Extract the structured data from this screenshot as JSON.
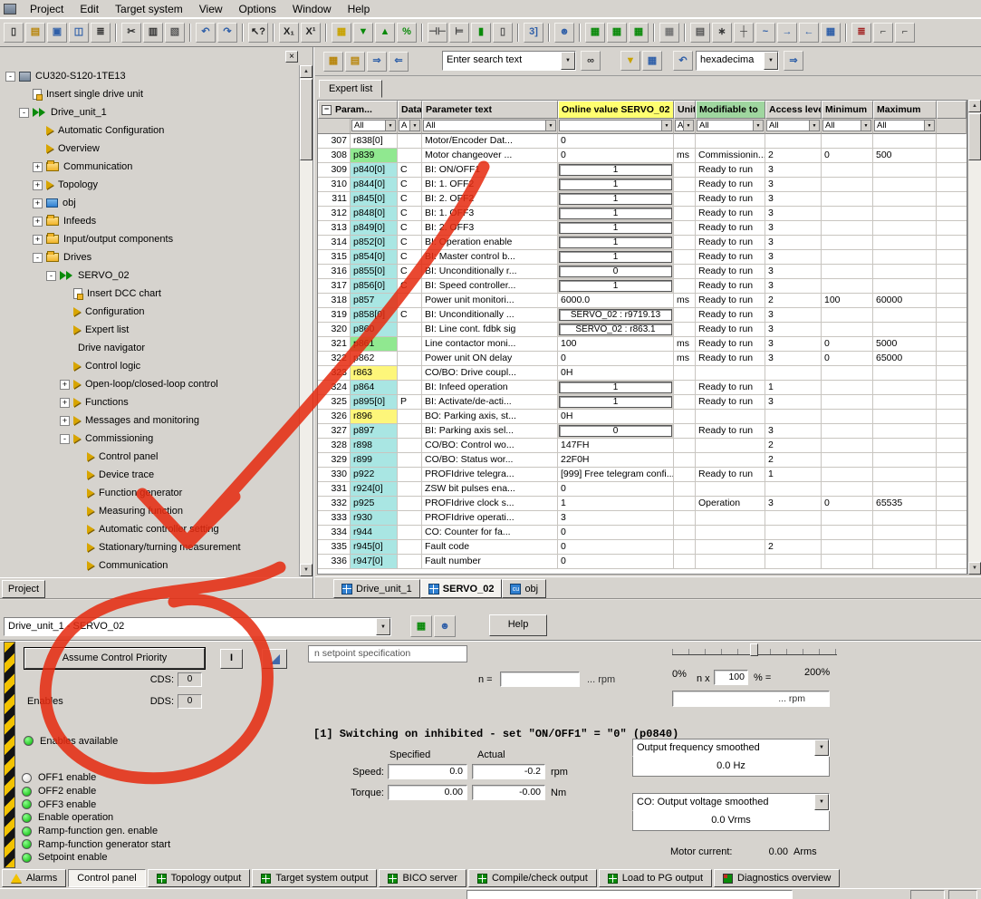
{
  "colors": {
    "annotation_red": "#e62b10",
    "online_header_bg": "#ffff70",
    "modifiable_header_bg": "#9fd69f",
    "param_cyan": "#a9e6e3",
    "param_green": "#90e890",
    "param_yellow": "#fdf67a",
    "param_white": "#ffffff",
    "led_on": "#00b400",
    "led_off": "#d8d5d0"
  },
  "menu": {
    "items": [
      "Project",
      "Edit",
      "Target system",
      "View",
      "Options",
      "Window",
      "Help"
    ]
  },
  "toolbar_main": {
    "buttons": [
      {
        "n": "new-document-icon",
        "g": "▯",
        "c": "#333333"
      },
      {
        "n": "open-folder-icon",
        "g": "▤",
        "c": "#b8860b"
      },
      {
        "n": "save-icon",
        "g": "▣",
        "c": "#2f5fa8"
      },
      {
        "n": "save-compile-icon",
        "g": "◫",
        "c": "#2f5fa8"
      },
      {
        "n": "print-icon",
        "g": "≣",
        "c": "#333333"
      },
      {
        "sep": true
      },
      {
        "n": "cut-icon",
        "g": "✂",
        "c": "#333333"
      },
      {
        "n": "copy-icon",
        "g": "▥",
        "c": "#333333"
      },
      {
        "n": "paste-icon",
        "g": "▧",
        "c": "#555555"
      },
      {
        "sep": true
      },
      {
        "n": "undo-icon",
        "g": "↶",
        "c": "#2f5fa8"
      },
      {
        "n": "redo-icon",
        "g": "↷",
        "c": "#2f5fa8"
      },
      {
        "sep": true
      },
      {
        "n": "help-pointer-icon",
        "g": "↖?",
        "c": "#222222"
      },
      {
        "sep": true
      },
      {
        "n": "x-sub-icon",
        "g": "X₁",
        "c": "#222222"
      },
      {
        "n": "x-sup-icon",
        "g": "X¹",
        "c": "#222222"
      },
      {
        "sep": true
      },
      {
        "n": "accessible-params-icon",
        "g": "▦",
        "c": "#c8a200"
      },
      {
        "n": "download-target-icon",
        "g": "▼",
        "c": "#0a8a0a"
      },
      {
        "n": "upload-pg-icon",
        "g": "▲",
        "c": "#0a8a0a"
      },
      {
        "n": "compare-params-icon",
        "g": "%",
        "c": "#0a8a0a"
      },
      {
        "sep": true
      },
      {
        "n": "disconnect-icon",
        "g": "⊣⊢",
        "c": "#444444"
      },
      {
        "n": "connect-icon",
        "g": "⊨",
        "c": "#444444"
      },
      {
        "n": "online-icon",
        "g": "▮",
        "c": "#0a8a0a"
      },
      {
        "n": "offline-icon",
        "g": "▯",
        "c": "#555555"
      },
      {
        "sep": true
      },
      {
        "n": "datasets-icon",
        "g": "3]",
        "c": "#2f5fa8"
      },
      {
        "sep": true
      },
      {
        "n": "users-icon",
        "g": "☻",
        "c": "#2f5fa8"
      },
      {
        "sep": true
      },
      {
        "n": "chart-1-icon",
        "g": "▦",
        "c": "#0a8a0a"
      },
      {
        "n": "chart-2-icon",
        "g": "▦",
        "c": "#0a8a0a"
      },
      {
        "n": "chart-3-icon",
        "g": "▦",
        "c": "#0a8a0a"
      },
      {
        "sep": true
      },
      {
        "n": "watch-table-icon",
        "g": "▦",
        "c": "#777777"
      },
      {
        "sep": true
      },
      {
        "n": "book-icon",
        "g": "▤",
        "c": "#555555"
      },
      {
        "n": "gear-icon",
        "g": "∗",
        "c": "#333333"
      },
      {
        "n": "insert-row-icon",
        "g": "┼",
        "c": "#444444"
      },
      {
        "n": "curve-icon",
        "g": "~",
        "c": "#2f5fa8"
      },
      {
        "n": "move-right-icon",
        "g": "→",
        "c": "#2f5fa8"
      },
      {
        "n": "move-left-icon",
        "g": "←",
        "c": "#2f5fa8"
      },
      {
        "n": "grid-select-icon",
        "g": "▦",
        "c": "#2f5fa8"
      },
      {
        "sep": true
      },
      {
        "n": "output-list-icon",
        "g": "≣",
        "c": "#a22222"
      },
      {
        "n": "dock-left-icon",
        "g": "⌐",
        "c": "#444444"
      },
      {
        "n": "dock-right-icon",
        "g": "⌐",
        "c": "#444444"
      }
    ]
  },
  "toolbar_list": {
    "icons_left": [
      {
        "n": "list-edit-icon",
        "g": "▦",
        "c": "#b8860b"
      },
      {
        "n": "list-open-icon",
        "g": "▤",
        "c": "#b8860b"
      },
      {
        "n": "list-import-icon",
        "g": "⇒",
        "c": "#2f5fa8"
      },
      {
        "n": "list-export-icon",
        "g": "⇐",
        "c": "#2f5fa8"
      }
    ],
    "search_value": "Enter search text",
    "format_value": "hexadecima"
  },
  "tree": {
    "items": [
      {
        "label": "CU320-S120-1TE13",
        "level": 0,
        "exp": "-",
        "icon": "cu"
      },
      {
        "label": "Insert single drive unit",
        "level": 1,
        "icon": "insert"
      },
      {
        "label": "Drive_unit_1",
        "level": 1,
        "exp": "-",
        "icon": "unit"
      },
      {
        "label": "Automatic Configuration",
        "level": 2,
        "icon": "arrow"
      },
      {
        "label": "Overview",
        "level": 2,
        "icon": "arrow"
      },
      {
        "label": "Communication",
        "level": 2,
        "exp": "+",
        "icon": "folder"
      },
      {
        "label": "Topology",
        "level": 2,
        "exp": "+",
        "icon": "arrow"
      },
      {
        "label": "obj",
        "level": 2,
        "exp": "+",
        "icon": "obj"
      },
      {
        "label": "Infeeds",
        "level": 2,
        "exp": "+",
        "icon": "folder"
      },
      {
        "label": "Input/output components",
        "level": 2,
        "exp": "+",
        "icon": "folder"
      },
      {
        "label": "Drives",
        "level": 2,
        "exp": "-",
        "icon": "folder"
      },
      {
        "label": "SERVO_02",
        "level": 3,
        "exp": "-",
        "icon": "drive"
      },
      {
        "label": "Insert DCC chart",
        "level": 4,
        "icon": "insert"
      },
      {
        "label": "Configuration",
        "level": 4,
        "icon": "arrow"
      },
      {
        "label": "Expert list",
        "level": 4,
        "icon": "arrow"
      },
      {
        "label": "Drive navigator",
        "level": 4,
        "icon": "navigator"
      },
      {
        "label": "Control logic",
        "level": 4,
        "icon": "arrow"
      },
      {
        "label": "Open-loop/closed-loop control",
        "level": 4,
        "exp": "+",
        "icon": "arrow"
      },
      {
        "label": "Functions",
        "level": 4,
        "exp": "+",
        "icon": "arrow"
      },
      {
        "label": "Messages and monitoring",
        "level": 4,
        "exp": "+",
        "icon": "arrow"
      },
      {
        "label": "Commissioning",
        "level": 4,
        "exp": "-",
        "icon": "arrow"
      },
      {
        "label": "Control panel",
        "level": 5,
        "icon": "arrow"
      },
      {
        "label": "Device trace",
        "level": 5,
        "icon": "arrow"
      },
      {
        "label": "Function generator",
        "level": 5,
        "icon": "arrow"
      },
      {
        "label": "Measuring function",
        "level": 5,
        "icon": "arrow"
      },
      {
        "label": "Automatic controller setting",
        "level": 5,
        "icon": "arrow"
      },
      {
        "label": "Stationary/turning measurement",
        "level": 5,
        "icon": "arrow"
      },
      {
        "label": "Communication",
        "level": 5,
        "icon": "arrow"
      }
    ]
  },
  "tabs": {
    "project_tab": "Project",
    "expert_tab": "Expert list",
    "doc_tabs": [
      {
        "label": "Drive_unit_1",
        "icon": "grid"
      },
      {
        "label": "SERVO_02",
        "icon": "grid",
        "active": true
      },
      {
        "label": "obj",
        "icon": "cu",
        "icon_text": "cu"
      }
    ]
  },
  "table": {
    "headers": [
      "Param...",
      "Data",
      "Parameter text",
      "Online value SERVO_02",
      "Unit",
      "Modifiable to",
      "Access level",
      "Minimum",
      "Maximum"
    ],
    "filters": [
      "All",
      "A",
      "All",
      "",
      "Al",
      "All",
      "All",
      "All",
      "All"
    ],
    "rows": [
      {
        "n": "307",
        "p": "r838[0]",
        "pc": "w",
        "d": "",
        "t": "Motor/Encoder Dat...",
        "v": "0",
        "b": 0,
        "u": "",
        "m": "",
        "a": "",
        "mi": "",
        "ma": ""
      },
      {
        "n": "308",
        "p": "p839",
        "pc": "g",
        "d": "",
        "t": "Motor changeover ...",
        "v": "0",
        "b": 0,
        "u": "ms",
        "m": "Commissionin...",
        "a": "2",
        "mi": "0",
        "ma": "500"
      },
      {
        "n": "309",
        "p": "p840[0]",
        "pc": "c",
        "d": "C",
        "t": "BI: ON/OFF1",
        "v": "1",
        "b": 1,
        "u": "",
        "m": "Ready to run",
        "a": "3",
        "mi": "",
        "ma": ""
      },
      {
        "n": "310",
        "p": "p844[0]",
        "pc": "c",
        "d": "C",
        "t": "BI: 1. OFF2",
        "v": "1",
        "b": 1,
        "u": "",
        "m": "Ready to run",
        "a": "3",
        "mi": "",
        "ma": ""
      },
      {
        "n": "311",
        "p": "p845[0]",
        "pc": "c",
        "d": "C",
        "t": "BI: 2. OFF2",
        "v": "1",
        "b": 1,
        "u": "",
        "m": "Ready to run",
        "a": "3",
        "mi": "",
        "ma": ""
      },
      {
        "n": "312",
        "p": "p848[0]",
        "pc": "c",
        "d": "C",
        "t": "BI: 1. OFF3",
        "v": "1",
        "b": 1,
        "u": "",
        "m": "Ready to run",
        "a": "3",
        "mi": "",
        "ma": ""
      },
      {
        "n": "313",
        "p": "p849[0]",
        "pc": "c",
        "d": "C",
        "t": "BI: 2. OFF3",
        "v": "1",
        "b": 1,
        "u": "",
        "m": "Ready to run",
        "a": "3",
        "mi": "",
        "ma": ""
      },
      {
        "n": "314",
        "p": "p852[0]",
        "pc": "c",
        "d": "C",
        "t": "BI: Operation enable",
        "v": "1",
        "b": 1,
        "u": "",
        "m": "Ready to run",
        "a": "3",
        "mi": "",
        "ma": ""
      },
      {
        "n": "315",
        "p": "p854[0]",
        "pc": "c",
        "d": "C",
        "t": "BI: Master control b...",
        "v": "1",
        "b": 1,
        "u": "",
        "m": "Ready to run",
        "a": "3",
        "mi": "",
        "ma": ""
      },
      {
        "n": "316",
        "p": "p855[0]",
        "pc": "c",
        "d": "C",
        "t": "BI: Unconditionally r...",
        "v": "0",
        "b": 1,
        "u": "",
        "m": "Ready to run",
        "a": "3",
        "mi": "",
        "ma": ""
      },
      {
        "n": "317",
        "p": "p856[0]",
        "pc": "c",
        "d": "C",
        "t": "BI: Speed controller...",
        "v": "1",
        "b": 1,
        "u": "",
        "m": "Ready to run",
        "a": "3",
        "mi": "",
        "ma": ""
      },
      {
        "n": "318",
        "p": "p857",
        "pc": "c",
        "d": "",
        "t": "Power unit monitori...",
        "v": "6000.0",
        "b": 0,
        "u": "ms",
        "m": "Ready to run",
        "a": "2",
        "mi": "100",
        "ma": "60000"
      },
      {
        "n": "319",
        "p": "p858[0]",
        "pc": "c",
        "d": "C",
        "t": "BI: Unconditionally ...",
        "v": "SERVO_02 : r9719.13",
        "b": 1,
        "u": "",
        "m": "Ready to run",
        "a": "3",
        "mi": "",
        "ma": ""
      },
      {
        "n": "320",
        "p": "p860",
        "pc": "c",
        "d": "",
        "t": "BI: Line cont. fdbk sig",
        "v": "SERVO_02 : r863.1",
        "b": 1,
        "u": "",
        "m": "Ready to run",
        "a": "3",
        "mi": "",
        "ma": ""
      },
      {
        "n": "321",
        "p": "p861",
        "pc": "g",
        "d": "",
        "t": "Line contactor moni...",
        "v": "100",
        "b": 0,
        "u": "ms",
        "m": "Ready to run",
        "a": "3",
        "mi": "0",
        "ma": "5000"
      },
      {
        "n": "322",
        "p": "p862",
        "pc": "w",
        "d": "",
        "t": "Power unit ON delay",
        "v": "0",
        "b": 0,
        "u": "ms",
        "m": "Ready to run",
        "a": "3",
        "mi": "0",
        "ma": "65000"
      },
      {
        "n": "323",
        "p": "r863",
        "pc": "y",
        "d": "",
        "t": "CO/BO: Drive coupl...",
        "v": "0H",
        "b": 0,
        "u": "",
        "m": "",
        "a": "",
        "mi": "",
        "ma": ""
      },
      {
        "n": "324",
        "p": "p864",
        "pc": "c",
        "d": "",
        "t": "BI: Infeed operation",
        "v": "1",
        "b": 1,
        "u": "",
        "m": "Ready to run",
        "a": "1",
        "mi": "",
        "ma": ""
      },
      {
        "n": "325",
        "p": "p895[0]",
        "pc": "c",
        "d": "P",
        "t": "BI: Activate/de-acti...",
        "v": "1",
        "b": 1,
        "u": "",
        "m": "Ready to run",
        "a": "3",
        "mi": "",
        "ma": ""
      },
      {
        "n": "326",
        "p": "r896",
        "pc": "y",
        "d": "",
        "t": "BO: Parking axis, st...",
        "v": "0H",
        "b": 0,
        "u": "",
        "m": "",
        "a": "",
        "mi": "",
        "ma": ""
      },
      {
        "n": "327",
        "p": "p897",
        "pc": "c",
        "d": "",
        "t": "BI: Parking axis sel...",
        "v": "0",
        "b": 1,
        "u": "",
        "m": "Ready to run",
        "a": "3",
        "mi": "",
        "ma": ""
      },
      {
        "n": "328",
        "p": "r898",
        "pc": "c",
        "d": "",
        "t": "CO/BO: Control wo...",
        "v": "147FH",
        "b": 0,
        "u": "",
        "m": "",
        "a": "2",
        "mi": "",
        "ma": ""
      },
      {
        "n": "329",
        "p": "r899",
        "pc": "c",
        "d": "",
        "t": "CO/BO: Status wor...",
        "v": "22F0H",
        "b": 0,
        "u": "",
        "m": "",
        "a": "2",
        "mi": "",
        "ma": ""
      },
      {
        "n": "330",
        "p": "p922",
        "pc": "c",
        "d": "",
        "t": "PROFIdrive telegra...",
        "v": "[999] Free telegram confi...",
        "b": 0,
        "u": "",
        "m": "Ready to run",
        "a": "1",
        "mi": "",
        "ma": ""
      },
      {
        "n": "331",
        "p": "r924[0]",
        "pc": "c",
        "d": "",
        "t": "ZSW bit pulses ena...",
        "v": "0",
        "b": 0,
        "u": "",
        "m": "",
        "a": "",
        "mi": "",
        "ma": ""
      },
      {
        "n": "332",
        "p": "p925",
        "pc": "c",
        "d": "",
        "t": "PROFIdrive clock s...",
        "v": "1",
        "b": 0,
        "u": "",
        "m": "Operation",
        "a": "3",
        "mi": "0",
        "ma": "65535"
      },
      {
        "n": "333",
        "p": "r930",
        "pc": "c",
        "d": "",
        "t": "PROFIdrive operati...",
        "v": "3",
        "b": 0,
        "u": "",
        "m": "",
        "a": "",
        "mi": "",
        "ma": ""
      },
      {
        "n": "334",
        "p": "r944",
        "pc": "c",
        "d": "",
        "t": "CO: Counter for fa...",
        "v": "0",
        "b": 0,
        "u": "",
        "m": "",
        "a": "",
        "mi": "",
        "ma": ""
      },
      {
        "n": "335",
        "p": "r945[0]",
        "pc": "c",
        "d": "",
        "t": "Fault code",
        "v": "0",
        "b": 0,
        "u": "",
        "m": "",
        "a": "2",
        "mi": "",
        "ma": ""
      },
      {
        "n": "336",
        "p": "r947[0]",
        "pc": "c",
        "d": "",
        "t": "Fault number",
        "v": "0",
        "b": 0,
        "u": "",
        "m": "",
        "a": "",
        "mi": "",
        "ma": ""
      }
    ]
  },
  "control_panel": {
    "drive_combo": "Drive_unit_1 - SERVO_02",
    "help_button": "Help",
    "assume_button": "Assume Control Priority",
    "on_button": "I",
    "enables_label": "Enables",
    "cds_label": "CDS:",
    "cds_value": "0",
    "dds_label": "DDS:",
    "dds_value": "0",
    "enables_available": "Enables available",
    "setpoint_box": "n setpoint specification",
    "n_label": "n =",
    "n_suffix": "... rpm",
    "slider": {
      "left": "0%",
      "nx": "n x",
      "value": "100",
      "eq": "% =",
      "right": "200%",
      "ref": "... rpm"
    },
    "status_message": "[1] Switching on inhibited - set \"ON/OFF1\" = \"0\" (p0840)",
    "specified_label": "Specified",
    "actual_label": "Actual",
    "speed_label": "Speed:",
    "speed_specified": "0.0",
    "speed_actual": "-0.2",
    "speed_unit": "rpm",
    "torque_label": "Torque:",
    "torque_specified": "0.00",
    "torque_actual": "-0.00",
    "torque_unit": "Nm",
    "freq_combo": "Output frequency smoothed",
    "freq_value": "0.0 Hz",
    "volt_combo": "CO: Output voltage smoothed",
    "volt_value": "0.0 Vrms",
    "motor_current_label": "Motor current:",
    "motor_current_value": "0.00",
    "motor_current_unit": "Arms",
    "leds": [
      {
        "label": "OFF1 enable",
        "state": "off"
      },
      {
        "label": "OFF2 enable",
        "state": "on"
      },
      {
        "label": "OFF3 enable",
        "state": "on"
      },
      {
        "label": "Enable operation",
        "state": "on"
      },
      {
        "label": "Ramp-function gen. enable",
        "state": "on"
      },
      {
        "label": "Ramp-function generator start",
        "state": "on"
      },
      {
        "label": "Setpoint enable",
        "state": "on"
      }
    ]
  },
  "bottom_tabs": [
    {
      "label": "Alarms",
      "icon": "alarm"
    },
    {
      "label": "Control panel",
      "icon": "none",
      "active": true
    },
    {
      "label": "Topology output",
      "icon": "grid"
    },
    {
      "label": "Target system output",
      "icon": "grid"
    },
    {
      "label": "BICO server",
      "icon": "grid"
    },
    {
      "label": "Compile/check output",
      "icon": "grid"
    },
    {
      "label": "Load to PG output",
      "icon": "grid"
    },
    {
      "label": "Diagnostics overview",
      "icon": "diag"
    }
  ]
}
